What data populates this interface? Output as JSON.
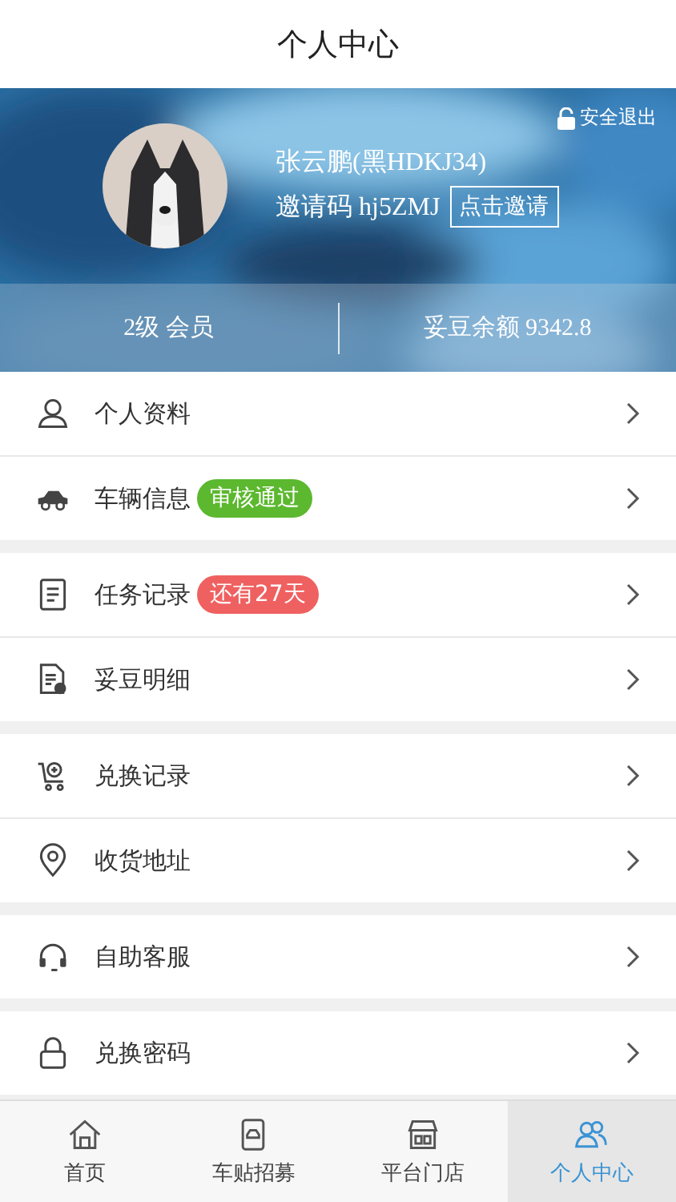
{
  "header": {
    "title": "个人中心"
  },
  "profile": {
    "logout": "安全退出",
    "name": "张云鹏(黑HDKJ34)",
    "invite_label": "邀请码 hj5ZMJ",
    "invite_button": "点击邀请",
    "level": "2级 会员",
    "balance": "妥豆余额 9342.8"
  },
  "groups": [
    [
      {
        "label": "个人资料"
      },
      {
        "label": "车辆信息",
        "badge": {
          "text": "审核通过",
          "color": "#5cb82f"
        }
      }
    ],
    [
      {
        "label": "任务记录",
        "badge": {
          "text": "还有27天",
          "color": "#ef6161"
        }
      },
      {
        "label": "妥豆明细"
      }
    ],
    [
      {
        "label": "兑换记录"
      },
      {
        "label": "收货地址"
      }
    ],
    [
      {
        "label": "自助客服"
      }
    ],
    [
      {
        "label": "兑换密码"
      }
    ]
  ],
  "tabs": [
    {
      "label": "首页",
      "selected": false
    },
    {
      "label": "车贴招募",
      "selected": false
    },
    {
      "label": "平台门店",
      "selected": false
    },
    {
      "label": "个人中心",
      "selected": true
    }
  ]
}
